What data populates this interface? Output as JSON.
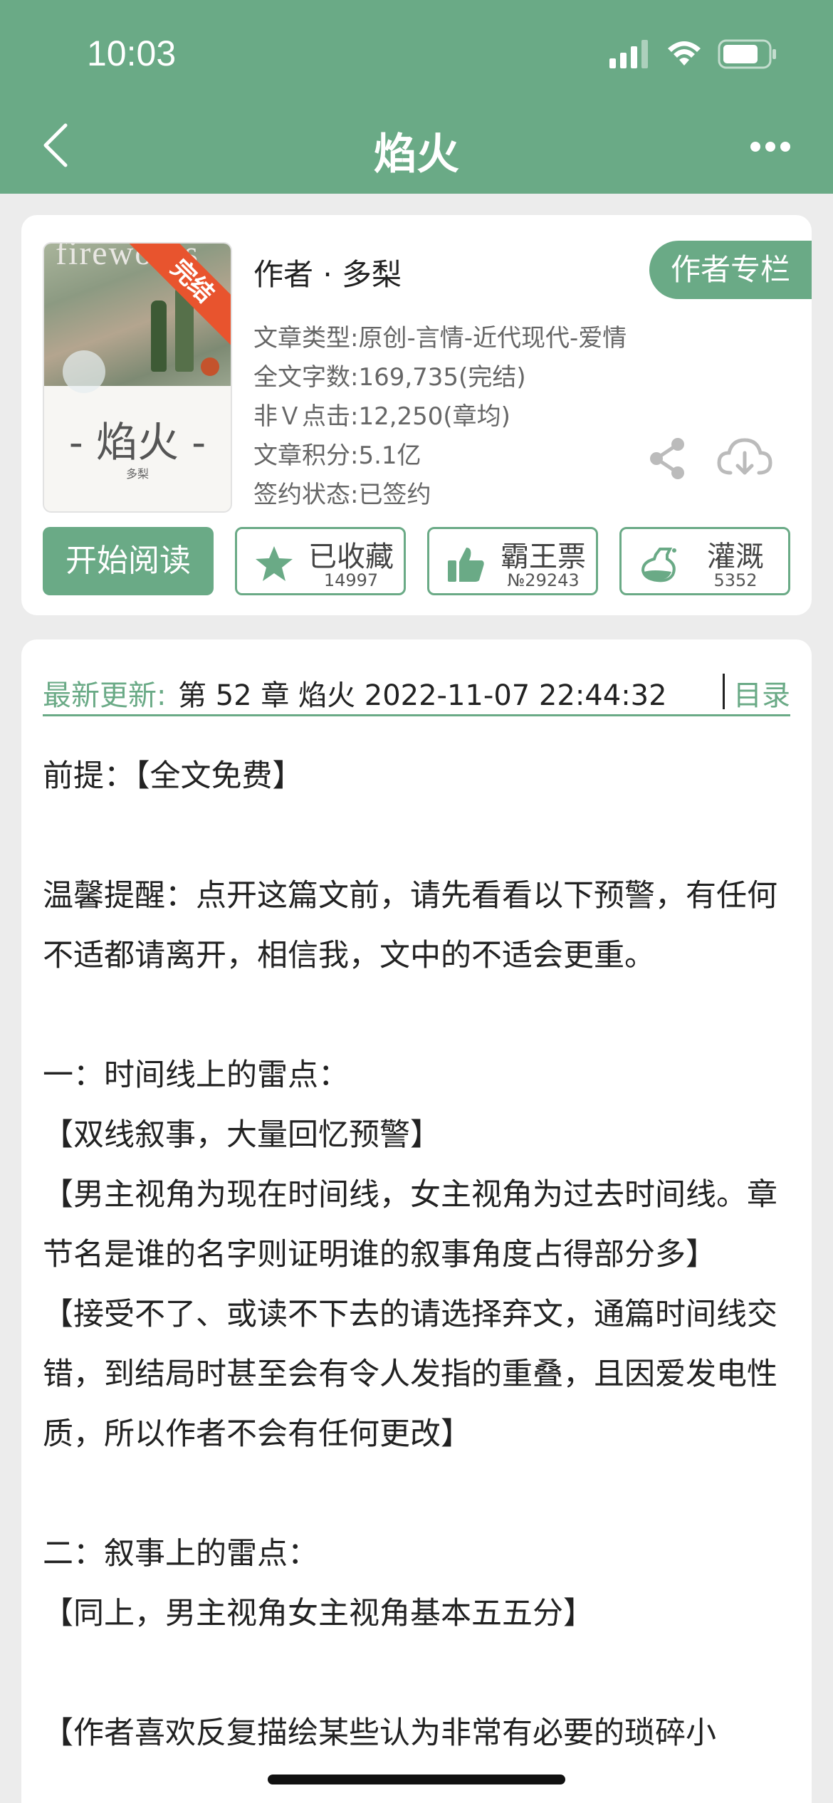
{
  "status_bar": {
    "time": "10:03"
  },
  "nav": {
    "title": "焰火"
  },
  "book": {
    "cover": {
      "top_text": "fireworks",
      "title": "- 焰火 -",
      "author": "多梨",
      "ribbon": "完结"
    },
    "author_line": "作者 · 多梨",
    "author_column_label": "作者专栏",
    "meta": {
      "type": "文章类型:原创-言情-近代现代-爱情",
      "words": "全文字数:169,735(完结)",
      "clicks": "非Ｖ点击:12,250(章均)",
      "score": "文章积分:5.1亿",
      "sign": "签约状态:已签约"
    },
    "actions": {
      "start_read": "开始阅读",
      "favorite": {
        "label": "已收藏",
        "count": "14997"
      },
      "vote": {
        "label": "霸王票",
        "count": "№29243"
      },
      "water": {
        "label": "灌溉",
        "count": "5352"
      }
    }
  },
  "content": {
    "update_label": "最新更新:",
    "update_text": "第 52 章 焰火 2022-11-07 22:44:32",
    "toc_label": "目录",
    "paragraphs": [
      "前提：【全文免费】",
      "",
      "温馨提醒：点开这篇文前，请先看看以下预警，有任何不适都请离开，相信我，文中的不适会更重。",
      "",
      "一：时间线上的雷点：",
      "【双线叙事，大量回忆预警】",
      "【男主视角为现在时间线，女主视角为过去时间线。章节名是谁的名字则证明谁的叙事角度占得部分多】",
      "【接受不了、或读不下去的请选择弃文，通篇时间线交错，到结局时甚至会有令人发指的重叠，且因爱发电性质，所以作者不会有任何更改】",
      "",
      "二：叙事上的雷点：",
      "【同上，男主视角女主视角基本五五分】",
      "",
      "【作者喜欢反复描绘某些认为非常有必要的琐碎小"
    ]
  },
  "colors": {
    "accent": "#6aaa86",
    "ribbon": "#e8542e",
    "background": "#ececec"
  }
}
